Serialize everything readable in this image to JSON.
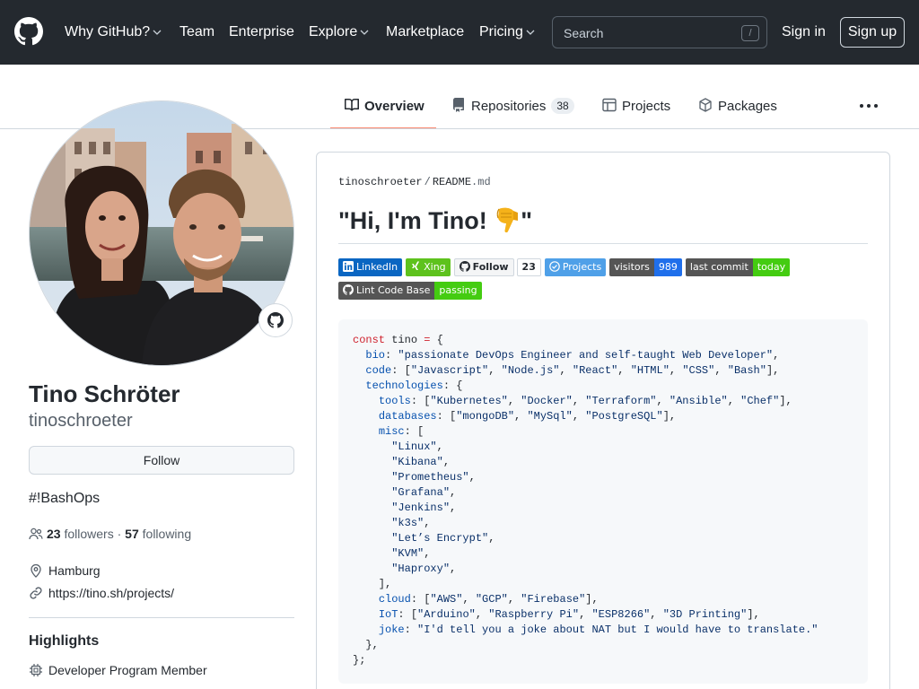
{
  "header": {
    "nav": [
      {
        "label": "Why GitHub?",
        "dropdown": true
      },
      {
        "label": "Team",
        "dropdown": false
      },
      {
        "label": "Enterprise",
        "dropdown": false
      },
      {
        "label": "Explore",
        "dropdown": true
      },
      {
        "label": "Marketplace",
        "dropdown": false
      },
      {
        "label": "Pricing",
        "dropdown": true
      }
    ],
    "search_placeholder": "Search",
    "search_shortcut": "/",
    "sign_in": "Sign in",
    "sign_up": "Sign up"
  },
  "tabs": [
    {
      "label": "Overview",
      "icon": "book-icon",
      "active": true
    },
    {
      "label": "Repositories",
      "icon": "repo-icon",
      "count": "38"
    },
    {
      "label": "Projects",
      "icon": "project-icon"
    },
    {
      "label": "Packages",
      "icon": "package-icon"
    }
  ],
  "profile": {
    "full_name": "Tino Schröter",
    "username": "tinoschroeter",
    "follow_button": "Follow",
    "bio": "#!BashOps",
    "followers_count": "23",
    "followers_label": "followers",
    "separator": "·",
    "following_count": "57",
    "following_label": "following",
    "location": "Hamburg",
    "website": "https://tino.sh/projects/",
    "highlights_title": "Highlights",
    "highlight": "Developer Program Member"
  },
  "readme": {
    "owner": "tinoschroeter",
    "path_sep": "/",
    "file_name": "README",
    "file_ext": ".md",
    "title": "\"Hi, I'm Tino! ",
    "title_end": "\"",
    "badges_row1": [
      {
        "left": "LinkedIn",
        "color": "#0a66c2",
        "icon": "linkedin-icon"
      },
      {
        "left": "Xing",
        "color": "#5ec21d",
        "icon": "xing-icon"
      }
    ],
    "github_follow": {
      "label": "Follow",
      "count": "23"
    },
    "badges_row1b": [
      {
        "left": "Projects",
        "color": "#4fa0e8",
        "icon": "check-circle-icon"
      },
      {
        "left": "visitors",
        "right": "989",
        "left_color": "#555555",
        "right_color": "#1f6feb"
      },
      {
        "left": "last commit",
        "right": "today",
        "left_color": "#555555",
        "right_color": "#4c1"
      }
    ],
    "badge_row2": {
      "left": "Lint Code Base",
      "right": "passing",
      "left_color": "#555555",
      "right_color": "#4c1"
    },
    "code": {
      "line1_kw": "const",
      "line1_var": " tino ",
      "line1_op": "=",
      "line1_end": " {",
      "bio_key": "bio",
      "bio_val": "\"passionate DevOps Engineer and self-taught Web Developer\"",
      "code_key": "code",
      "code_vals": [
        "\"Javascript\"",
        "\"Node.js\"",
        "\"React\"",
        "\"HTML\"",
        "\"CSS\"",
        "\"Bash\""
      ],
      "tech_key": "technologies",
      "tools_key": "tools",
      "tools_vals": [
        "\"Kubernetes\"",
        "\"Docker\"",
        "\"Terraform\"",
        "\"Ansible\"",
        "\"Chef\""
      ],
      "db_key": "databases",
      "db_vals": [
        "\"mongoDB\"",
        "\"MySql\"",
        "\"PostgreSQL\""
      ],
      "misc_key": "misc",
      "misc_vals": [
        "\"Linux\"",
        "\"Kibana\"",
        "\"Prometheus\"",
        "\"Grafana\"",
        "\"Jenkins\"",
        "\"k3s\"",
        "\"Let’s Encrypt\"",
        "\"KVM\"",
        "\"Haproxy\""
      ],
      "cloud_key": "cloud",
      "cloud_vals": [
        "\"AWS\"",
        "\"GCP\"",
        "\"Firebase\""
      ],
      "iot_key": "IoT",
      "iot_vals": [
        "\"Arduino\"",
        "\"Raspberry Pi\"",
        "\"ESP8266\"",
        "\"3D Printing\""
      ],
      "joke_key": "joke",
      "joke_val": "\"I'd tell you a joke about NAT but I would have to translate.\""
    }
  },
  "colors": {
    "header_bg": "#24292f",
    "tab_underline": "#fd8c73",
    "code_keyword": "#cf222e",
    "code_property": "#0550ae",
    "code_string": "#0a3069"
  }
}
